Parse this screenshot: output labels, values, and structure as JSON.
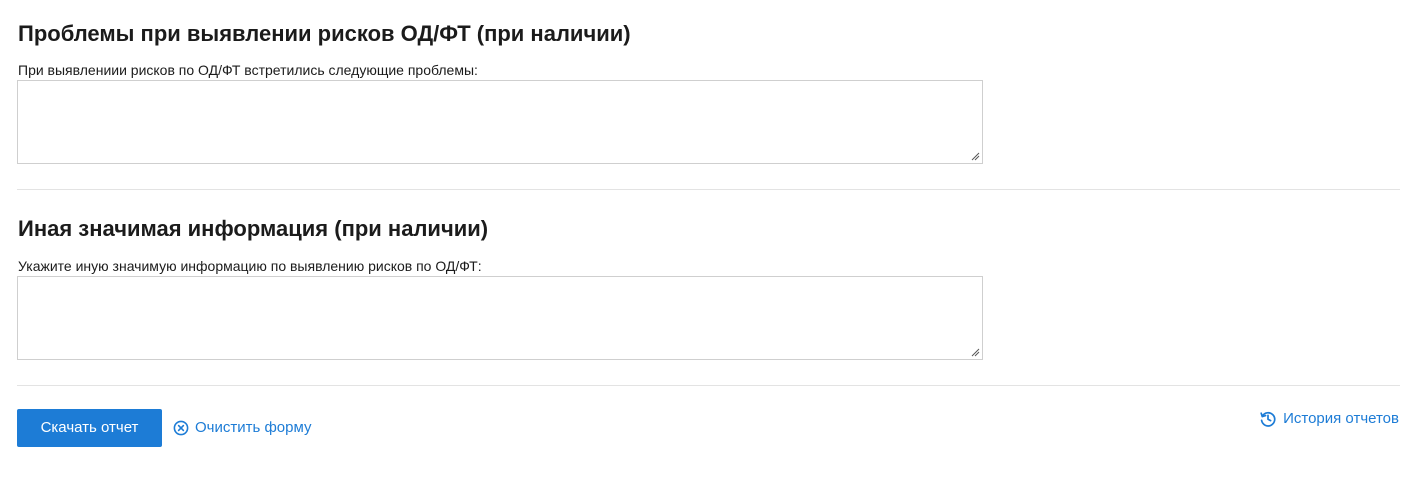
{
  "sections": [
    {
      "title": "Проблемы при выявлении рисков ОД/ФТ (при наличии)",
      "label": "При выявлениии рисков по ОД/ФТ встретились следующие проблемы:",
      "value": ""
    },
    {
      "title": "Иная значимая информация (при наличии)",
      "label": "Укажите иную значимую информацию по выявлению рисков по ОД/ФТ:",
      "value": ""
    }
  ],
  "actions": {
    "download_label": "Скачать отчет",
    "clear_label": "Очистить форму",
    "history_label": "История отчетов"
  },
  "colors": {
    "accent": "#1d7cd6",
    "text": "#1b1b1b",
    "border": "#cfcfcf",
    "divider": "#e3e3e3"
  }
}
